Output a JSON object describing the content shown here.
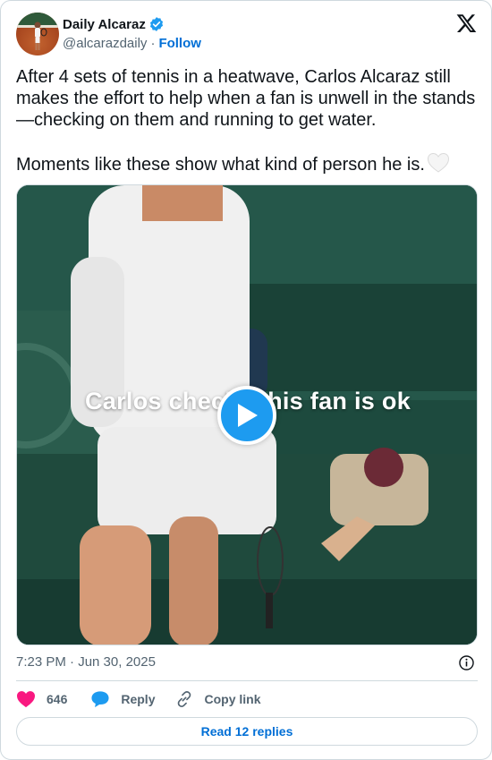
{
  "author": {
    "display_name": "Daily Alcaraz",
    "handle": "@alcarazdaily",
    "separator": "·",
    "follow_label": "Follow",
    "verified": true
  },
  "tweet": {
    "text": "After 4 sets of tennis in a heatwave, Carlos Alcaraz still makes the effort to help when a fan is unwell in the stands—checking on them and running to get water.\n\nMoments like these show what kind of person he is.",
    "emoji": "white-heart-icon"
  },
  "media": {
    "caption": "Carlos checks this fan is ok",
    "type": "video"
  },
  "meta": {
    "timestamp": "7:23 PM · Jun 30, 2025"
  },
  "actions": {
    "like_count": "646",
    "reply_label": "Reply",
    "copy_label": "Copy link",
    "read_replies_label": "Read 12 replies"
  },
  "colors": {
    "accent": "#1d9bf0",
    "link": "#006fd6",
    "like": "#f91880",
    "muted": "#536471"
  }
}
